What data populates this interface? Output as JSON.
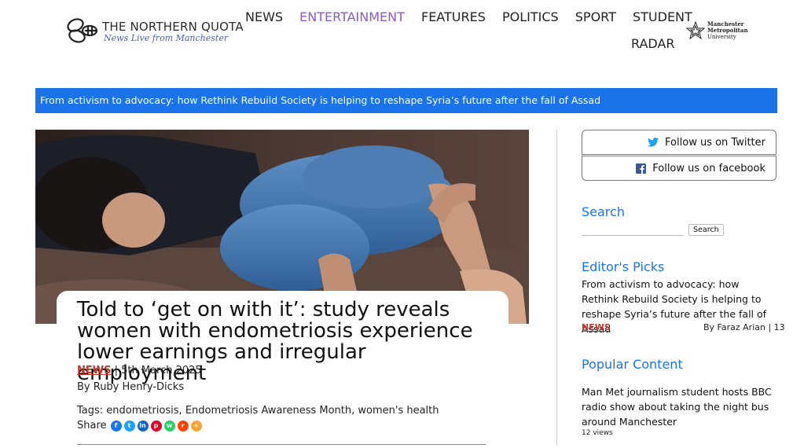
{
  "brand": {
    "name": "THE NORTHERN QUOTA",
    "tagline": "News Live from Manchester"
  },
  "nav": {
    "items": [
      "NEWS",
      "ENTERTAINMENT",
      "FEATURES",
      "POLITICS",
      "SPORT",
      "STUDENT"
    ],
    "radar": "RADAR",
    "active": "ENTERTAINMENT",
    "active_color": "#8a5cc0"
  },
  "partner": {
    "line1": "Manchester",
    "line2": "Metropolitan",
    "line3": "University"
  },
  "ticker": {
    "text": "From activism to advocacy: how Rethink Rebuild Society is helping to reshape Syria’s future after the fall of Assad",
    "color": "#1a73e8"
  },
  "article": {
    "headline": "Told to ‘get on with it’: study reveals women with endometriosis experience lower earnings and irregular employment",
    "category": "NEWS",
    "date": "| 5th March 2025",
    "byline": "By Ruby Henry-Dicks",
    "tags": "Tags: endometriosis, Endometriosis Awareness Month, women's health",
    "share_label": "Share",
    "share_icons": [
      "facebook-icon",
      "twitter-icon",
      "linkedin-icon",
      "pinterest-icon",
      "whatsapp-icon",
      "reddit-icon",
      "more-icon"
    ]
  },
  "sidebar": {
    "twitter": "Follow us on Twitter",
    "facebook": "Follow us on facebook",
    "search_heading": "Search",
    "search_button": "Search",
    "search_placeholder": "",
    "editors_heading": "Editor's Picks",
    "editors_pick": {
      "title": "From activism to advocacy: how Rethink Rebuild Society is helping to reshape Syria’s future after the fall of Assad",
      "category": "NEWS",
      "byline": "By Faraz Arian | 13"
    },
    "popular_heading": "Popular Content",
    "popular": {
      "title": "Man Met journalism student hosts BBC radio show about taking the night bus around Manchester",
      "views": "12 views"
    }
  }
}
